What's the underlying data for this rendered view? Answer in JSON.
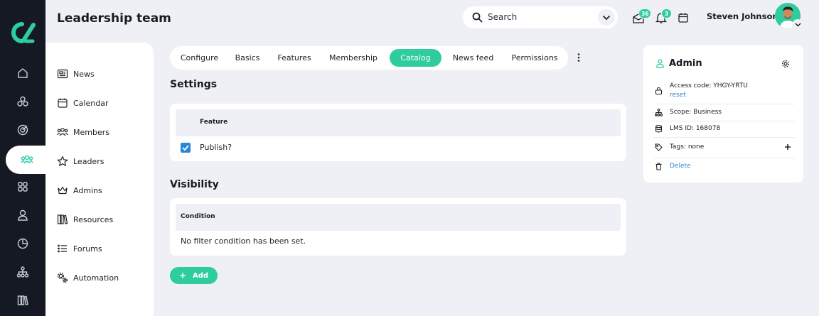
{
  "header": {
    "title": "Leadership team",
    "search_placeholder": "Search",
    "messages_badge": "36",
    "notifications_badge": "3",
    "user_name": "Steven Johnson"
  },
  "rail": {
    "items": [
      "home-icon",
      "groups-icon",
      "target-icon",
      "team-icon",
      "apps-icon",
      "user-icon",
      "analytics-icon",
      "hierarchy-icon",
      "library-icon"
    ],
    "active": "team-icon"
  },
  "sidebar": {
    "items": [
      {
        "label": "News",
        "icon": "newspaper-icon"
      },
      {
        "label": "Calendar",
        "icon": "calendar-icon"
      },
      {
        "label": "Members",
        "icon": "members-icon"
      },
      {
        "label": "Leaders",
        "icon": "star-icon"
      },
      {
        "label": "Admins",
        "icon": "crown-icon"
      },
      {
        "label": "Resources",
        "icon": "books-icon"
      },
      {
        "label": "Forums",
        "icon": "list-icon"
      },
      {
        "label": "Automation",
        "icon": "gears-icon"
      }
    ]
  },
  "tabs": [
    {
      "label": "Configure",
      "active": false
    },
    {
      "label": "Basics",
      "active": false
    },
    {
      "label": "Features",
      "active": false
    },
    {
      "label": "Membership",
      "active": false
    },
    {
      "label": "Catalog",
      "active": true
    },
    {
      "label": "News feed",
      "active": false
    },
    {
      "label": "Permissions",
      "active": false
    }
  ],
  "settings": {
    "title": "Settings",
    "column": "Feature",
    "row_label": "Publish?",
    "row_checked": true
  },
  "visibility": {
    "title": "Visibility",
    "column": "Condition",
    "empty_text": "No filter condition has been set."
  },
  "add_button": "Add",
  "panel": {
    "title": "Admin",
    "access_code": "Access code: YHGY-YRTU",
    "reset_label": "reset",
    "scope": "Scope: Business",
    "lms_id": "LMS ID: 168078",
    "tags": "Tags: none",
    "delete_label": "Delete"
  },
  "colors": {
    "accent": "#2fcc9f",
    "link": "#2a86d6",
    "rail_bg": "#141923",
    "page_bg": "#eef0f5"
  }
}
